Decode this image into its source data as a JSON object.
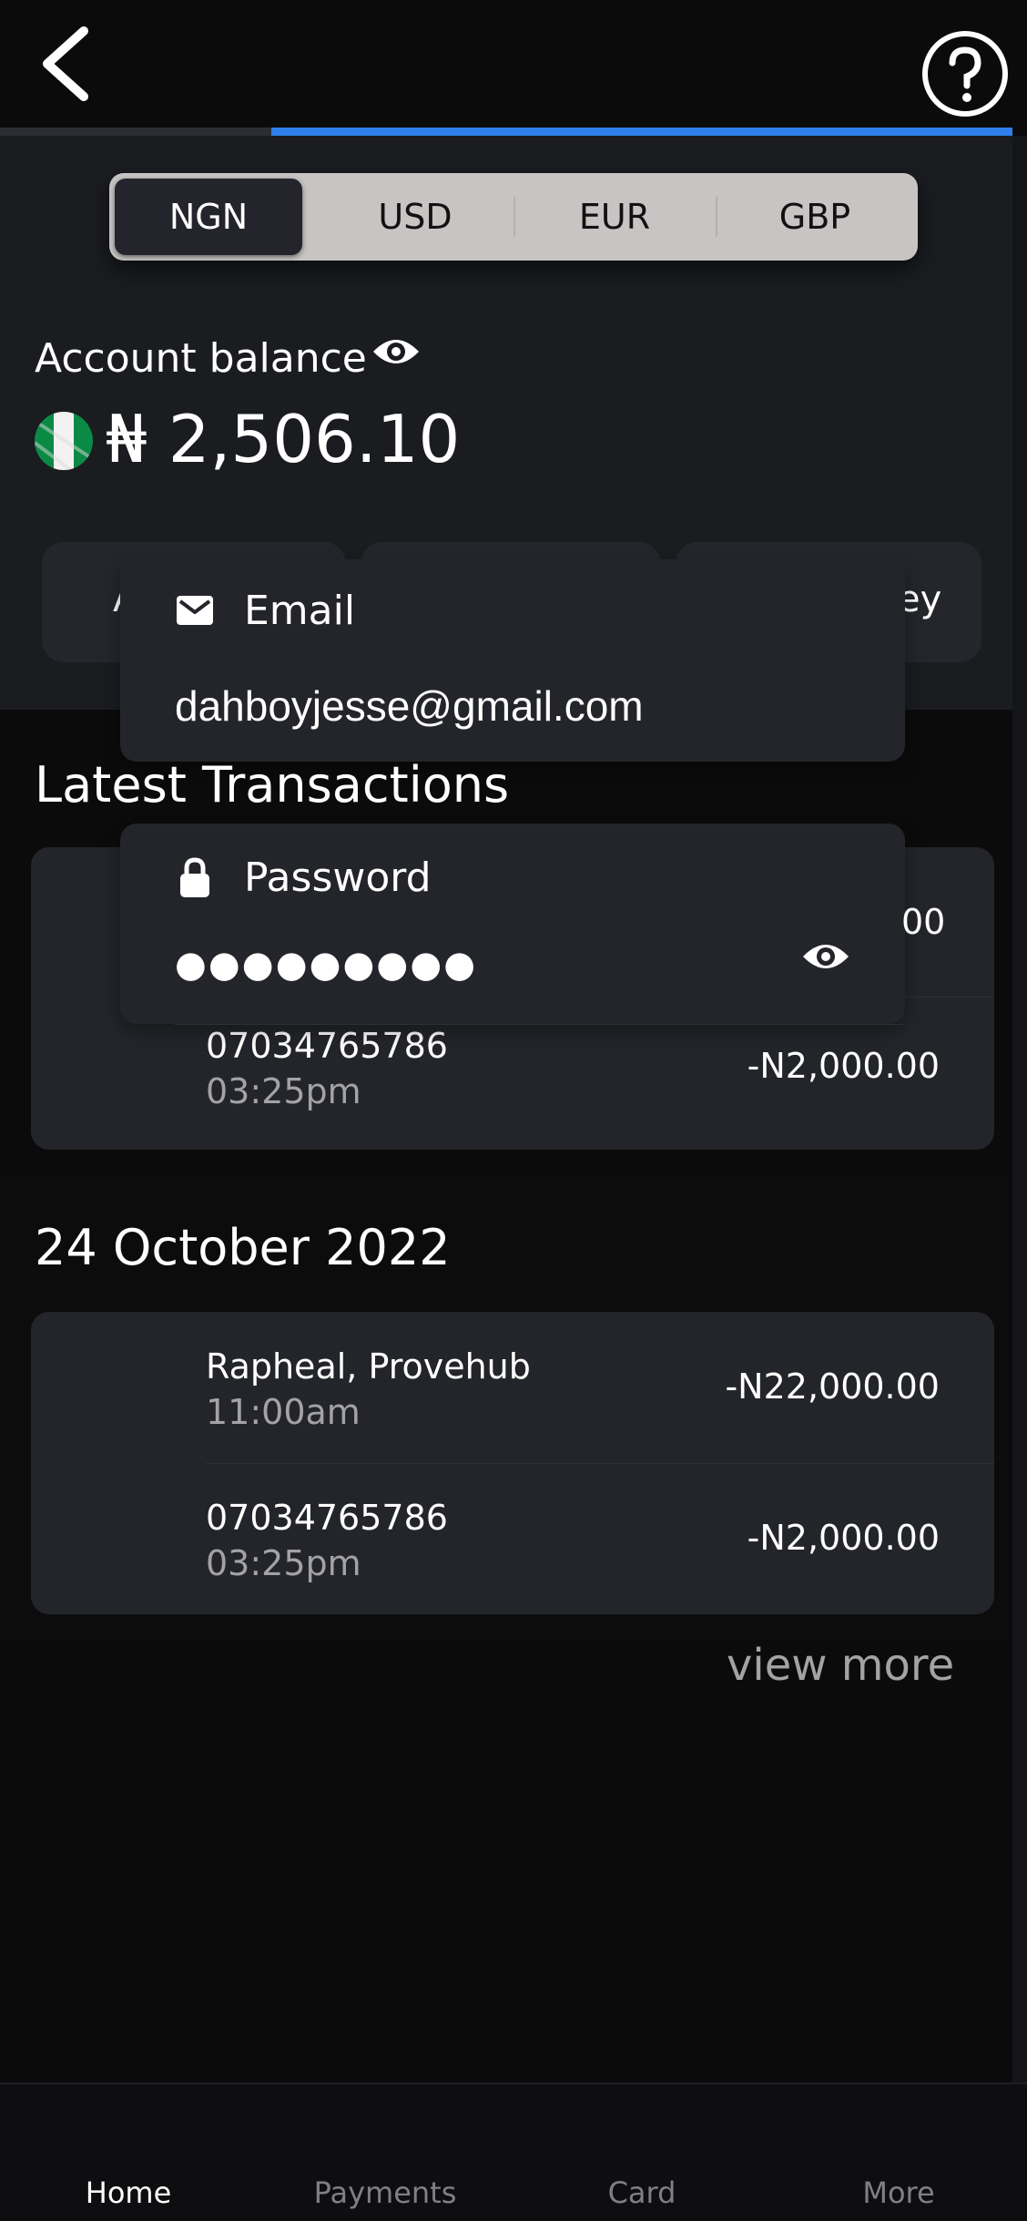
{
  "header": {
    "back_icon": "chevron-left-icon",
    "help_icon": "question-circle-icon",
    "progress": 0.73,
    "accent": "#2f80ed"
  },
  "currency_switch": {
    "tabs": [
      "NGN",
      "USD",
      "EUR",
      "GBP"
    ],
    "selected": "NGN"
  },
  "balance": {
    "label": "Account balance",
    "amount": "₦ 2,506.10",
    "eye_icon": "eye-icon",
    "flag": "nigeria-flag"
  },
  "action_tiles": {
    "left_fragment": "A",
    "right_fragment": "ey"
  },
  "login_popup": {
    "email_label": "Email",
    "email_value": "dahboyjesse@gmail.com",
    "password_label": "Password",
    "password_value": "●●●●●●●●●",
    "partial_amount": "00"
  },
  "latest_transactions": {
    "title": "Latest Transactions",
    "rows": [
      {
        "title": "07034765786",
        "time": "03:25pm",
        "amount": "-N2,000.00"
      }
    ]
  },
  "day_group": {
    "date": "24 October 2022",
    "rows": [
      {
        "title": "Rapheal, Provehub",
        "time": "11:00am",
        "amount": "-N22,000.00"
      },
      {
        "title": "07034765786",
        "time": "03:25pm",
        "amount": "-N2,000.00"
      }
    ]
  },
  "view_more": "view more",
  "bottom_nav": {
    "items": [
      "Home",
      "Payments",
      "Card",
      "More"
    ],
    "active": "Home"
  }
}
